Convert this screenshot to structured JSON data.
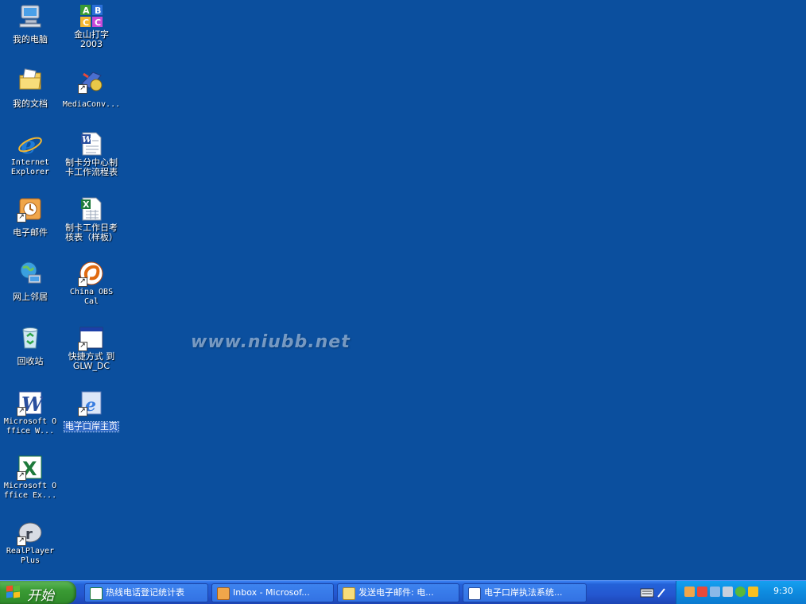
{
  "desktop": {
    "icons": [
      {
        "label": "我的电脑",
        "icon": "my-computer-icon"
      },
      {
        "label": "我的文档",
        "icon": "my-documents-icon"
      },
      {
        "label": "Internet Explorer",
        "icon": "internet-explorer-icon"
      },
      {
        "label": "电子邮件",
        "icon": "email-icon"
      },
      {
        "label": "网上邻居",
        "icon": "network-places-icon"
      },
      {
        "label": "回收站",
        "icon": "recycle-bin-icon"
      },
      {
        "label": "Microsoft Office W...",
        "icon": "word-icon"
      },
      {
        "label": "Microsoft Office Ex...",
        "icon": "excel-icon"
      },
      {
        "label": "RealPlayer Plus",
        "icon": "realplayer-icon"
      },
      {
        "label": "金山打字 2003",
        "icon": "kingsoft-typing-icon"
      },
      {
        "label": "MediaConv...",
        "icon": "mediaconv-icon"
      },
      {
        "label": "制卡分中心制卡工作流程表",
        "icon": "word-document-icon"
      },
      {
        "label": "制卡工作日考核表（样板）",
        "icon": "excel-document-icon"
      },
      {
        "label": "China OBS Cal",
        "icon": "china-obs-cal-icon"
      },
      {
        "label": "快捷方式 到 GLW_DC",
        "icon": "window-shortcut-icon"
      },
      {
        "label": "电子口岸主页",
        "icon": "ie-page-icon"
      }
    ],
    "watermark": "www.niubb.net"
  },
  "taskbar": {
    "start_label": "开始",
    "tasks": [
      {
        "label": "热线电话登记统计表",
        "icon": "excel-task-icon"
      },
      {
        "label": "Inbox - Microsof...",
        "icon": "outlook-task-icon"
      },
      {
        "label": "发送电子邮件: 电...",
        "icon": "email-task-icon"
      },
      {
        "label": "电子口岸执法系统...",
        "icon": "word-task-icon"
      }
    ],
    "clock": "9:30"
  }
}
